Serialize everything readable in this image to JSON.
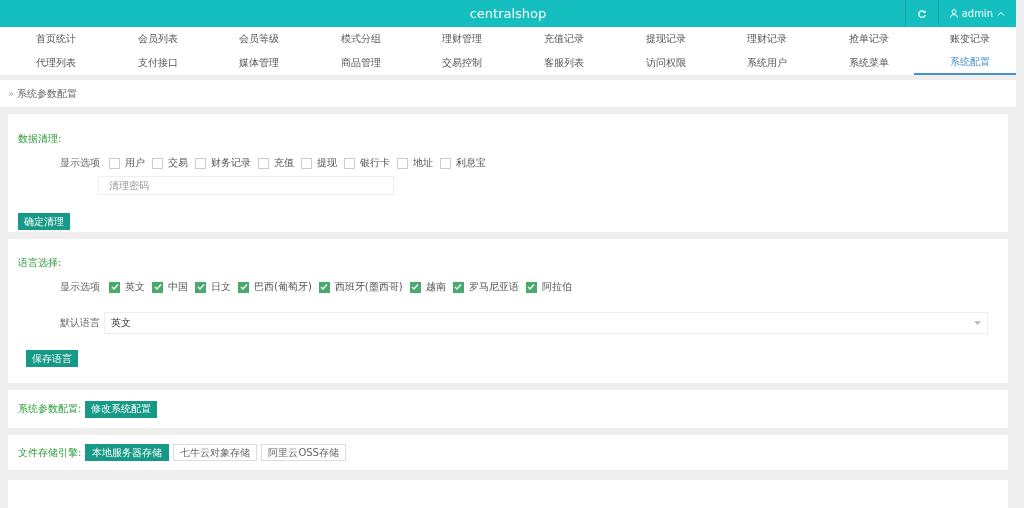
{
  "header": {
    "title": "centralshop",
    "user": "admin"
  },
  "nav": [
    [
      {
        "label": "首页统计",
        "selected": false
      },
      {
        "label": "会员列表",
        "selected": false
      },
      {
        "label": "会员等级",
        "selected": false
      },
      {
        "label": "模式分组",
        "selected": false
      },
      {
        "label": "理财管理",
        "selected": false
      },
      {
        "label": "充值记录",
        "selected": false
      },
      {
        "label": "提现记录",
        "selected": false
      },
      {
        "label": "理财记录",
        "selected": false
      },
      {
        "label": "抢单记录",
        "selected": false
      },
      {
        "label": "账变记录",
        "selected": false
      }
    ],
    [
      {
        "label": "代理列表",
        "selected": false
      },
      {
        "label": "支付接口",
        "selected": false
      },
      {
        "label": "媒体管理",
        "selected": false
      },
      {
        "label": "商品管理",
        "selected": false
      },
      {
        "label": "交易控制",
        "selected": false
      },
      {
        "label": "客服列表",
        "selected": false
      },
      {
        "label": "访问权限",
        "selected": false
      },
      {
        "label": "系统用户",
        "selected": false
      },
      {
        "label": "系统菜单",
        "selected": false
      },
      {
        "label": "系统配置",
        "selected": true
      }
    ]
  ],
  "breadcrumb_separator": "»",
  "breadcrumb": "系统参数配置",
  "data_clear": {
    "title": "数据清理:",
    "options_label": "显示选项",
    "options": [
      {
        "label": "用户",
        "checked": false
      },
      {
        "label": "交易",
        "checked": false
      },
      {
        "label": "财务记录",
        "checked": false
      },
      {
        "label": "充值",
        "checked": false
      },
      {
        "label": "提现",
        "checked": false
      },
      {
        "label": "银行卡",
        "checked": false
      },
      {
        "label": "地址",
        "checked": false
      },
      {
        "label": "利息宝",
        "checked": false
      }
    ],
    "password": {
      "placeholder": "清理密码"
    },
    "button": "确定清理"
  },
  "language": {
    "title": "语言选择:",
    "options_label": "显示选项",
    "options": [
      {
        "label": "英文",
        "checked": true
      },
      {
        "label": "中国",
        "checked": true
      },
      {
        "label": "日文",
        "checked": true
      },
      {
        "label": "巴西(葡萄牙)",
        "checked": true
      },
      {
        "label": "西班牙(墨西哥)",
        "checked": true
      },
      {
        "label": "越南",
        "checked": true
      },
      {
        "label": "罗马尼亚语",
        "checked": true
      },
      {
        "label": "阿拉伯",
        "checked": true
      }
    ],
    "default_label": "默认语言",
    "default_value": "英文",
    "button": "保存语言"
  },
  "system": {
    "title": "系统参数配置:",
    "button": "修改系统配置"
  },
  "storage": {
    "title": "文件存储引擎:",
    "engines": [
      {
        "label": "本地服务器存储",
        "selected": true
      },
      {
        "label": "七牛云对象存储",
        "selected": false
      },
      {
        "label": "阿里云OSS存储",
        "selected": false
      }
    ]
  }
}
